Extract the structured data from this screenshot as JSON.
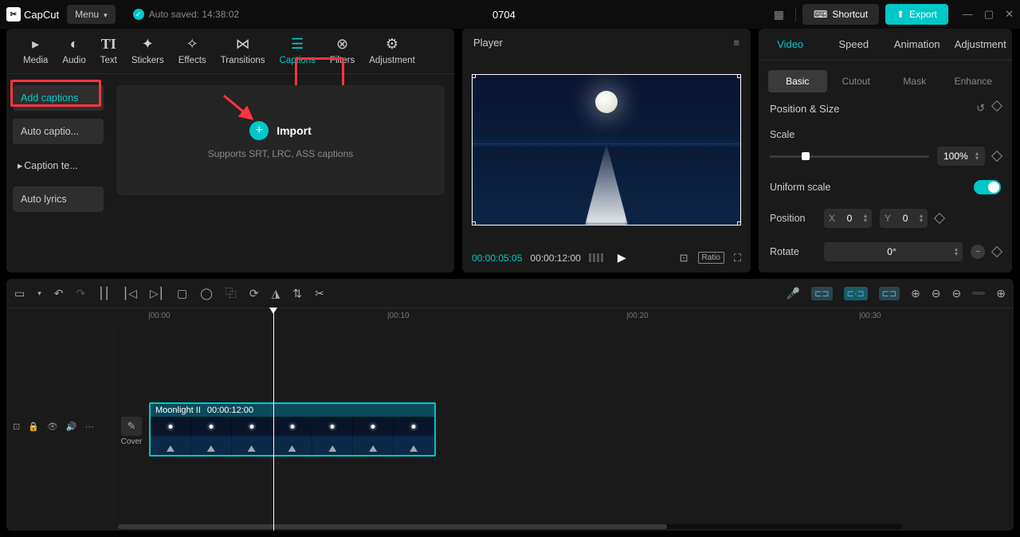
{
  "app": {
    "name": "CapCut",
    "menu_label": "Menu",
    "autosave": "Auto saved: 14:38:02",
    "project_title": "0704",
    "shortcut_label": "Shortcut",
    "export_label": "Export"
  },
  "top_tabs": {
    "media": "Media",
    "audio": "Audio",
    "text": "Text",
    "stickers": "Stickers",
    "effects": "Effects",
    "transitions": "Transitions",
    "captions": "Captions",
    "filters": "Filters",
    "adjustment": "Adjustment"
  },
  "left_sidebar": {
    "add_captions": "Add captions",
    "auto_captions": "Auto captio...",
    "caption_templates": "Caption te...",
    "auto_lyrics": "Auto lyrics"
  },
  "import": {
    "label": "Import",
    "subtext": "Supports SRT, LRC, ASS captions"
  },
  "player": {
    "title": "Player",
    "time_current": "00:00:05:05",
    "time_total": "00:00:12:00",
    "ratio_label": "Ratio"
  },
  "right_tabs": {
    "video": "Video",
    "speed": "Speed",
    "animation": "Animation",
    "adjustment": "Adjustment"
  },
  "sub_tabs": {
    "basic": "Basic",
    "cutout": "Cutout",
    "mask": "Mask",
    "enhance": "Enhance"
  },
  "props": {
    "section": "Position & Size",
    "scale_label": "Scale",
    "scale_value": "100%",
    "uniform_label": "Uniform scale",
    "position_label": "Position",
    "pos_x_label": "X",
    "pos_x_value": "0",
    "pos_y_label": "Y",
    "pos_y_value": "0",
    "rotate_label": "Rotate",
    "rotate_value": "0°"
  },
  "timeline": {
    "ruler": {
      "t0": "|00:00",
      "t10": "|00:10",
      "t20": "|00:20",
      "t30": "|00:30"
    },
    "clip_name": "Moonlight II",
    "clip_duration": "00:00:12:00",
    "cover_label": "Cover"
  }
}
